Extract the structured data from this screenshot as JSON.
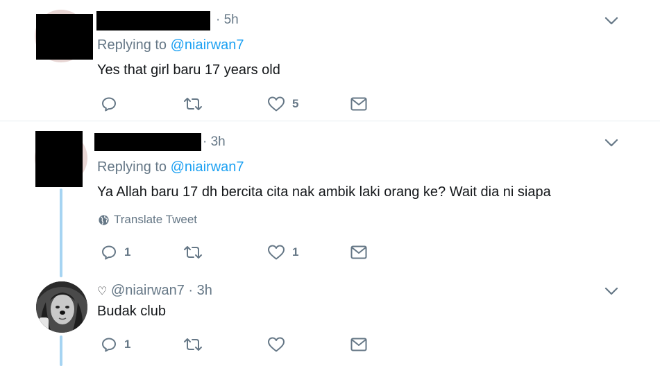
{
  "tweets": [
    {
      "time_sep": "· 5h",
      "replying_prefix": "Replying to",
      "replying_handle": "@niairwan7",
      "text": "Yes that girl baru 17 years old",
      "reply_count": "",
      "retweet_count": "",
      "like_count": "5"
    },
    {
      "time_sep": "· 3h",
      "replying_prefix": "Replying to",
      "replying_handle": "@niairwan7",
      "text": "Ya Allah baru 17 dh bercita cita nak ambik laki orang ke? Wait dia ni siapa",
      "translate_label": "Translate Tweet",
      "reply_count": "1",
      "retweet_count": "",
      "like_count": "1"
    },
    {
      "name_glyph": "♡",
      "handle": "@niairwan7",
      "time_sep": "· 3h",
      "text": "Budak club",
      "reply_count": "1",
      "retweet_count": "",
      "like_count": ""
    }
  ],
  "icons": {
    "reply": "reply-icon",
    "retweet": "retweet-icon",
    "like": "heart-icon",
    "dm": "envelope-icon",
    "more": "chevron-down-icon",
    "translate": "globe-icon"
  },
  "colors": {
    "link": "#1da1f2",
    "secondary_text": "#657786",
    "thread_line": "#a6d4f2"
  }
}
